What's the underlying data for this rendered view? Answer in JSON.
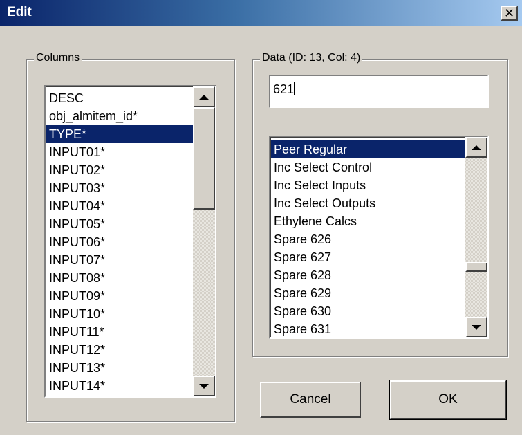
{
  "window": {
    "title": "Edit",
    "close_glyph": "✕"
  },
  "columns_group": {
    "label": "Columns",
    "items": [
      "DESC",
      "obj_almitem_id*",
      "TYPE*",
      "INPUT01*",
      "INPUT02*",
      "INPUT03*",
      "INPUT04*",
      "INPUT05*",
      "INPUT06*",
      "INPUT07*",
      "INPUT08*",
      "INPUT09*",
      "INPUT10*",
      "INPUT11*",
      "INPUT12*",
      "INPUT13*",
      "INPUT14*"
    ],
    "selected_index": 2
  },
  "data_group": {
    "label": "Data (ID: 13, Col: 4)",
    "input_value": "621",
    "items": [
      "Peer Regular",
      "Inc Select Control",
      "Inc Select Inputs",
      "Inc Select Outputs",
      "Ethylene Calcs",
      "Spare 626",
      "Spare 627",
      "Spare 628",
      "Spare 629",
      "Spare 630",
      "Spare 631"
    ],
    "selected_index": 0
  },
  "buttons": {
    "cancel": "Cancel",
    "ok": "OK"
  },
  "colors": {
    "selection": "#0a246a",
    "face": "#d4d0c8",
    "title_start": "#0a246a",
    "title_end": "#a6caf0"
  }
}
